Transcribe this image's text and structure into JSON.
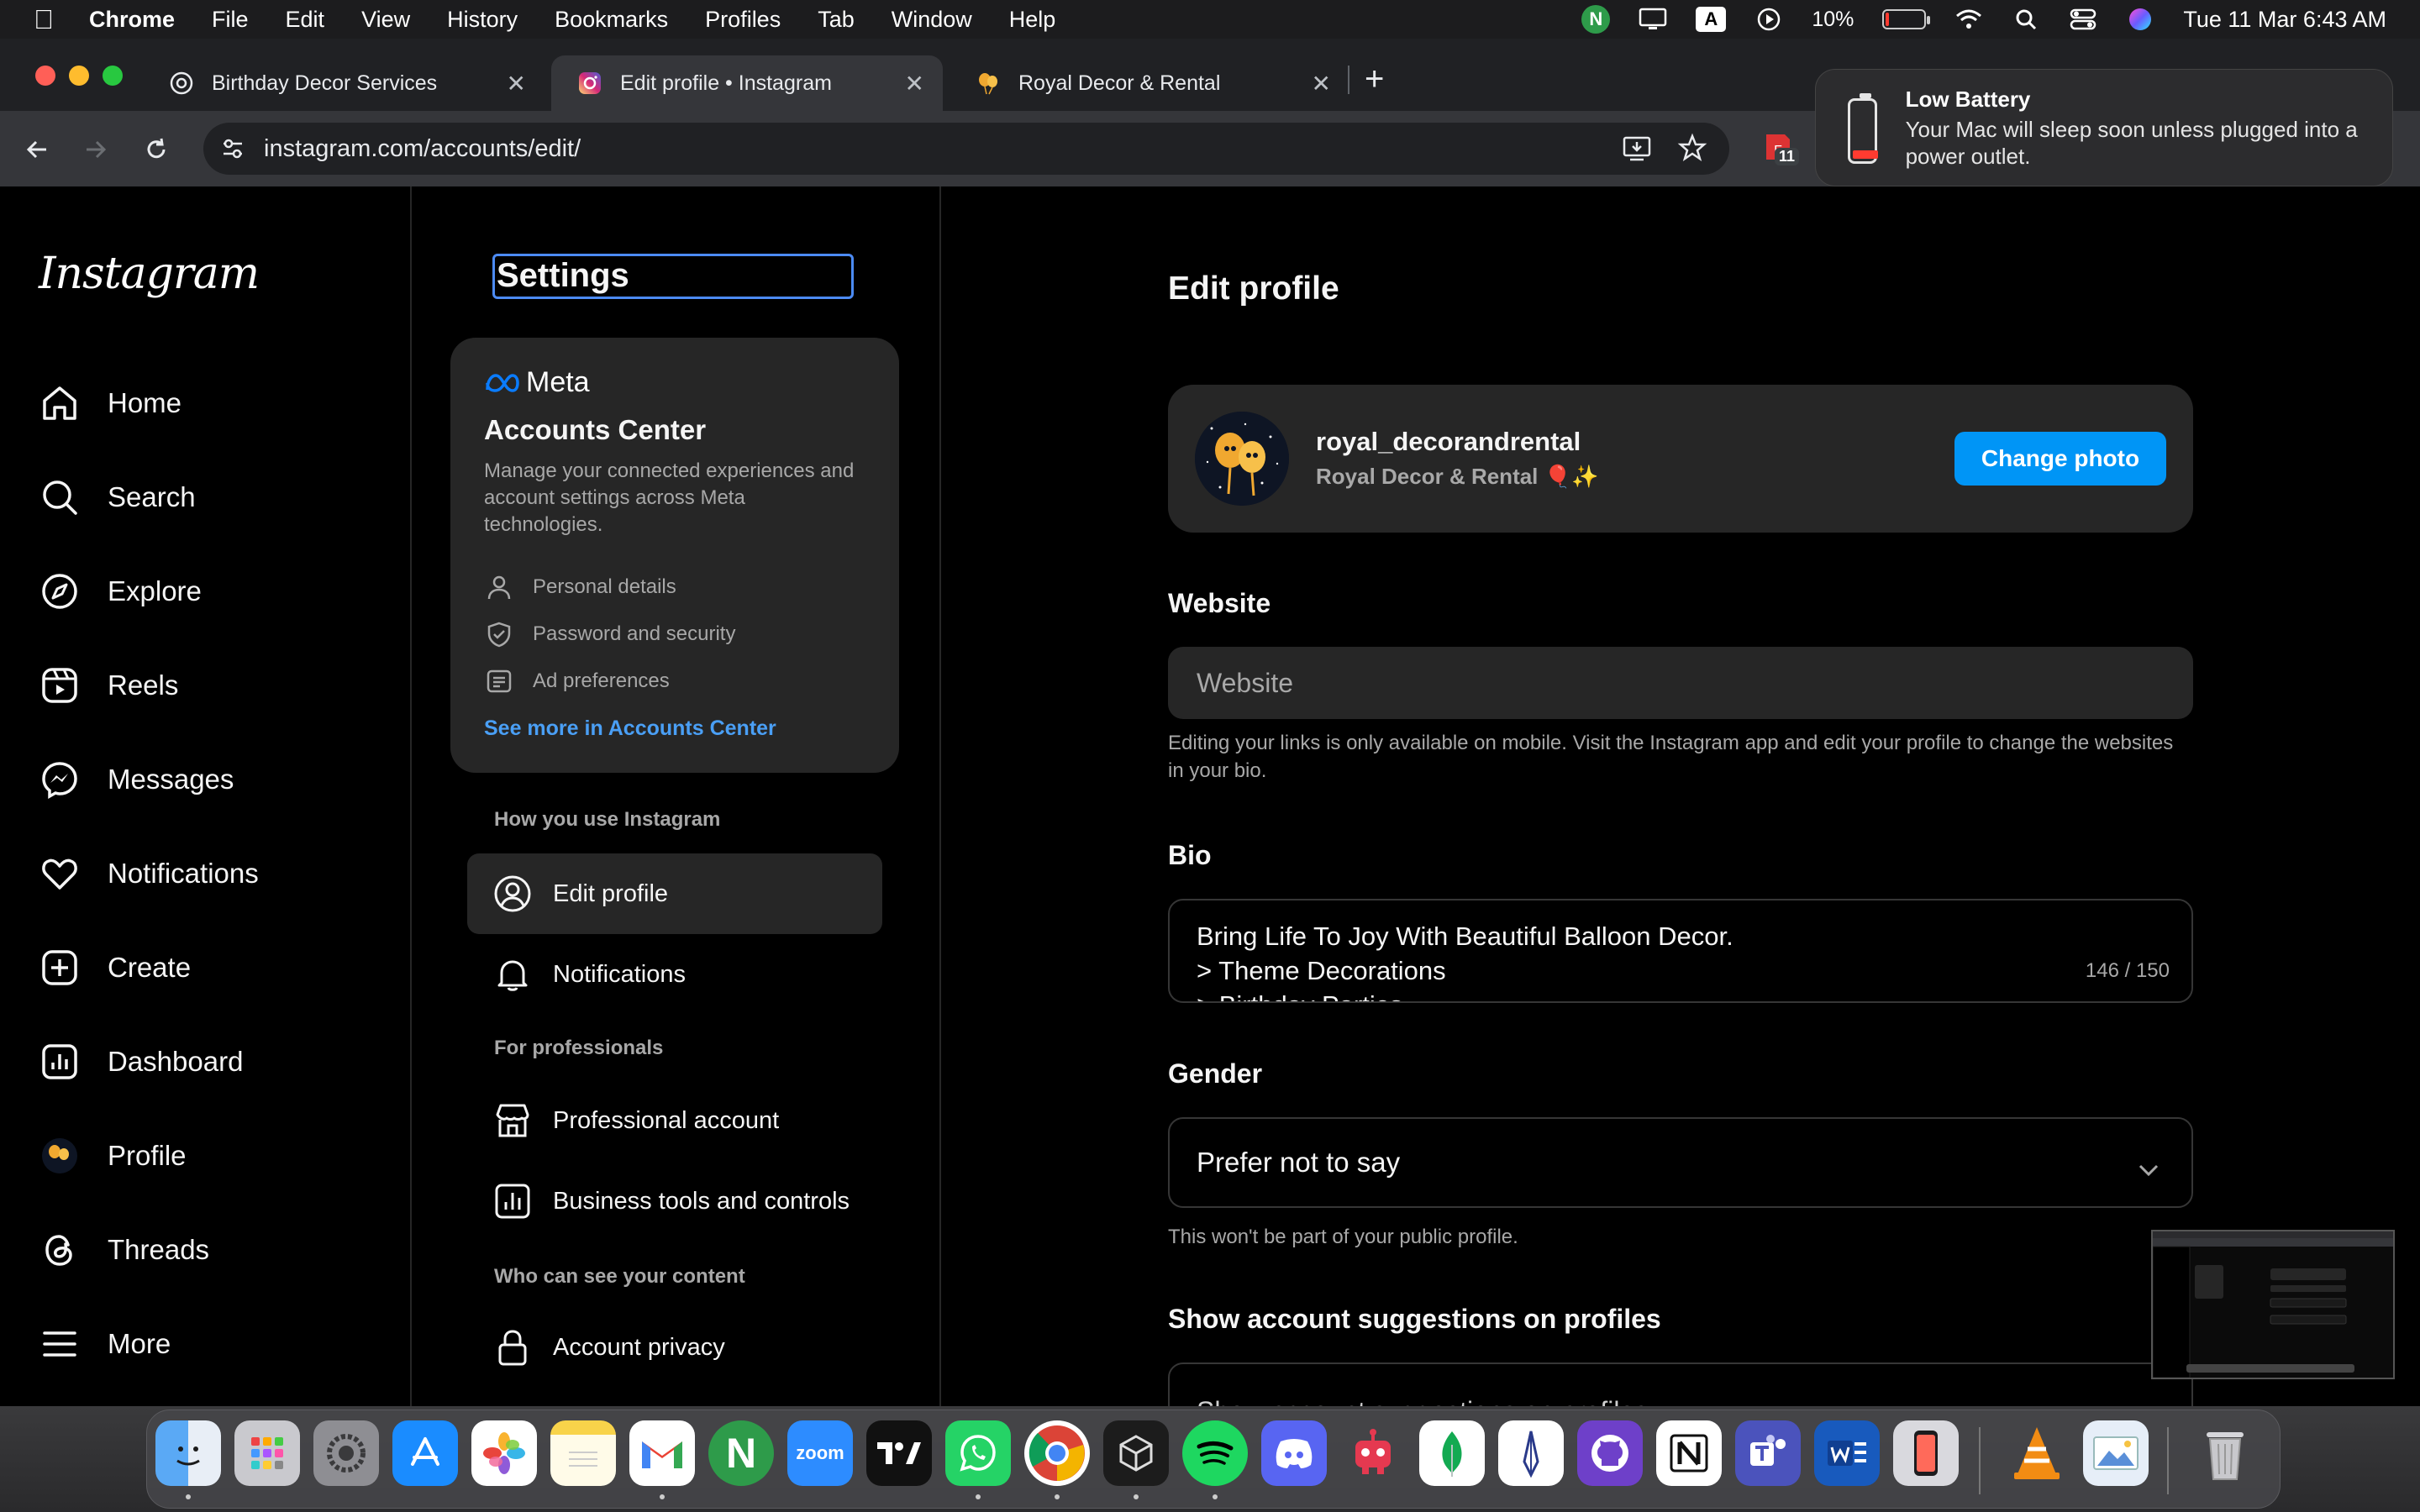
{
  "menubar": {
    "app": "Chrome",
    "items": [
      "File",
      "Edit",
      "View",
      "History",
      "Bookmarks",
      "Profiles",
      "Tab",
      "Window",
      "Help"
    ],
    "battery_percent": "10%",
    "battery_level": 0.1,
    "datetime": "Tue 11 Mar  6:43 AM",
    "input_badge": "A",
    "n_badge": "N"
  },
  "tabs": [
    {
      "title": "Birthday Decor Services",
      "active": false
    },
    {
      "title": "Edit profile • Instagram",
      "active": true
    },
    {
      "title": "Royal Decor & Rental",
      "active": false
    }
  ],
  "toolbar": {
    "url": "instagram.com/accounts/edit/",
    "ext_badge": "11"
  },
  "notification": {
    "title": "Low Battery",
    "body": "Your Mac will sleep soon unless plugged into a power outlet."
  },
  "ig_nav": {
    "logo": "Instagram",
    "items": [
      {
        "label": "Home",
        "icon": "home-icon"
      },
      {
        "label": "Search",
        "icon": "search-icon"
      },
      {
        "label": "Explore",
        "icon": "compass-icon"
      },
      {
        "label": "Reels",
        "icon": "reels-icon"
      },
      {
        "label": "Messages",
        "icon": "messenger-icon"
      },
      {
        "label": "Notifications",
        "icon": "heart-icon"
      },
      {
        "label": "Create",
        "icon": "plus-square-icon"
      },
      {
        "label": "Dashboard",
        "icon": "chart-icon"
      },
      {
        "label": "Profile",
        "icon": "avatar"
      },
      {
        "label": "Threads",
        "icon": "threads-icon"
      },
      {
        "label": "More",
        "icon": "menu-icon"
      }
    ]
  },
  "settings": {
    "title": "Settings",
    "accounts_center": {
      "brand": "Meta",
      "title": "Accounts Center",
      "description": "Manage your connected experiences and account settings across Meta technologies.",
      "links": [
        {
          "label": "Personal details",
          "icon": "person-icon"
        },
        {
          "label": "Password and security",
          "icon": "shield-icon"
        },
        {
          "label": "Ad preferences",
          "icon": "ad-icon"
        }
      ],
      "more": "See more in Accounts Center"
    },
    "sections": {
      "how_you_use": "How you use Instagram",
      "for_professionals": "For professionals",
      "who_can_see": "Who can see your content"
    },
    "items": {
      "edit_profile": "Edit profile",
      "notifications": "Notifications",
      "professional_account": "Professional account",
      "business_tools": "Business tools and controls",
      "account_privacy": "Account privacy"
    }
  },
  "edit_profile": {
    "heading": "Edit profile",
    "username": "royal_decorandrental",
    "full_name": "Royal Decor & Rental 🎈✨",
    "change_photo": "Change photo",
    "website_label": "Website",
    "website_placeholder": "Website",
    "website_help": "Editing your links is only available on mobile. Visit the Instagram app and edit your profile to change the websites in your bio.",
    "bio_label": "Bio",
    "bio_lines": [
      "Bring Life To Joy With Beautiful Balloon Decor.",
      "> Theme Decorations",
      "> Birthday Parties"
    ],
    "bio_count": "146 / 150",
    "gender_label": "Gender",
    "gender_value": "Prefer not to say",
    "gender_help": "This won't be part of your public profile.",
    "suggestions_label": "Show account suggestions on profiles",
    "suggestions_value": "Show account suggestions on profiles"
  },
  "dock": {
    "zoom_label": "zoom",
    "apps": [
      "finder",
      "launchpad",
      "system-settings",
      "app-store",
      "photos",
      "notes",
      "gmail",
      "n-app",
      "zoom",
      "tradingview",
      "whatsapp",
      "chrome",
      "cursor",
      "spotify",
      "discord",
      "bot-app",
      "mongodb",
      "pen-app",
      "github",
      "notion",
      "teams",
      "word",
      "iphone-mirroring",
      "vlc",
      "preview",
      "trash"
    ]
  },
  "colors": {
    "accent_blue": "#0095f6",
    "link_blue": "#4a9ff5",
    "card_bg": "#262626"
  }
}
